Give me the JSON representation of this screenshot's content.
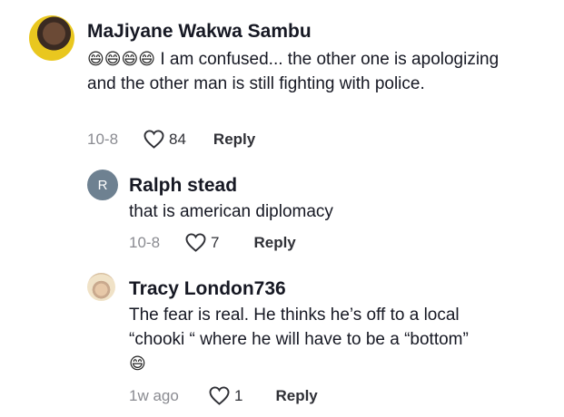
{
  "comments": [
    {
      "name": "MaJiyane Wakwa Sambu",
      "emoji": "😄😄😄😄",
      "text": " I am confused... the other one is apologizing and the other man is still fighting with police.",
      "date": "10-8",
      "likes": "84",
      "reply_label": "Reply"
    },
    {
      "avatar_letter": "R",
      "name": "Ralph stead",
      "text": "that is american diplomacy",
      "date": "10-8",
      "likes": "7",
      "reply_label": "Reply"
    },
    {
      "name": "Tracy London736",
      "text": "The fear is real. He thinks he’s off to a local “chooki “ where he will have to be a “bottom”",
      "emoji": "😄",
      "date": "1w ago",
      "likes": "1",
      "reply_label": "Reply"
    }
  ]
}
